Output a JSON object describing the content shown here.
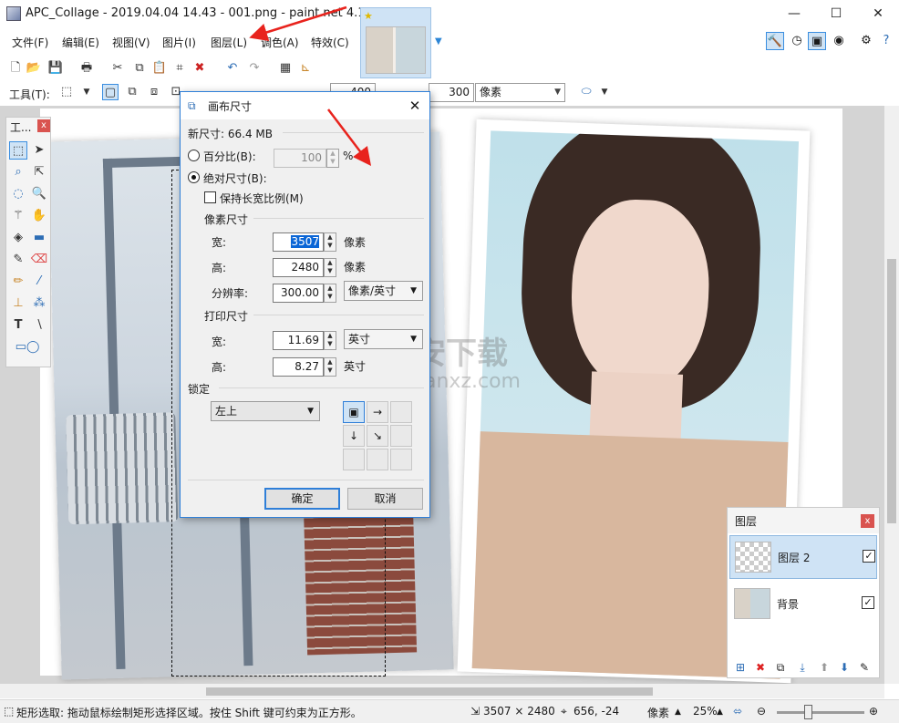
{
  "window": {
    "title": "APC_Collage - 2019.04.04 14.43 - 001.png - paint.net 4.1.4",
    "minimize": "—",
    "maximize": "☐",
    "close": "✕"
  },
  "menu": [
    "文件(F)",
    "编辑(E)",
    "视图(V)",
    "图片(I)",
    "图层(L)",
    "调色(A)",
    "特效(C)"
  ],
  "toolbar2": {
    "tool_label": "工具(T):",
    "width_value": "400",
    "height_value": "300",
    "unit": "像素"
  },
  "tools_panel": {
    "title": "工...",
    "close": "x"
  },
  "dialog": {
    "title": "画布尺寸",
    "close": "✕",
    "new_size_label": "新尺寸: 66.4 MB",
    "percent_label": "百分比(B):",
    "percent_value": "100",
    "percent_unit": "%",
    "absolute_label": "绝对尺寸(B):",
    "keep_ratio_label": "保持长宽比例(M)",
    "pixel_size_label": "像素尺寸",
    "width_label": "宽:",
    "width_value": "3507",
    "width_unit": "像素",
    "height_label": "高:",
    "height_value": "2480",
    "height_unit": "像素",
    "resolution_label": "分辨率:",
    "resolution_value": "300.00",
    "resolution_unit": "像素/英寸",
    "print_size_label": "打印尺寸",
    "print_width_label": "宽:",
    "print_width_value": "11.69",
    "print_width_unit": "英寸",
    "print_height_label": "高:",
    "print_height_value": "8.27",
    "print_height_unit": "英寸",
    "anchor_label": "锁定",
    "anchor_value": "左上",
    "ok_label": "确定",
    "cancel_label": "取消"
  },
  "layers_panel": {
    "title": "图层",
    "close": "x",
    "layers": [
      {
        "name": "图层 2",
        "visible": "✓"
      },
      {
        "name": "背景",
        "visible": "✓"
      }
    ]
  },
  "statusbar": {
    "hint": "矩形选取: 拖动鼠标绘制矩形选择区域。按住 Shift 键可约束为正方形。",
    "image_size": "3507 × 2480",
    "cursor_pos": "656, -24",
    "unit": "像素",
    "zoom": "25%"
  },
  "watermark": {
    "text": "安下载",
    "sub": "anxz.com"
  },
  "colors": {
    "accent": "#2f7fd8",
    "selection_highlight": "#cfe3f5",
    "annotation_arrow": "#e8231d"
  }
}
